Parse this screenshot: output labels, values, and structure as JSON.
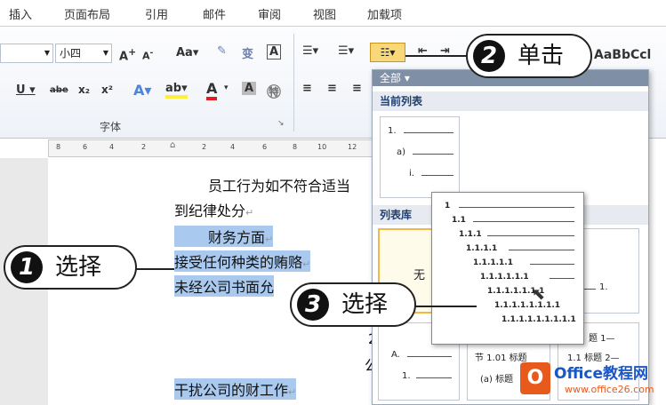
{
  "tabs": [
    "插入",
    "页面布局",
    "引用",
    "邮件",
    "审阅",
    "视图",
    "加载项"
  ],
  "font": {
    "size": "小四",
    "group_label": "字体"
  },
  "ribbon": {
    "grow": "A",
    "shrink": "A",
    "case": "Aa",
    "style_sample": "AaBbCcl"
  },
  "ruler_ticks": [
    "8",
    "6",
    "4",
    "2",
    "2",
    "4",
    "6",
    "8",
    "10",
    "12"
  ],
  "doc": {
    "line1": "员工行为如不符合适当",
    "line2": "到纪律处分",
    "line3": "财务方面",
    "line4": "接受任何种类的贿赂",
    "line5": "未经公司书面允",
    "line6": "干扰公司的财工作",
    "frag1": "公",
    "frag2": "2"
  },
  "panel": {
    "dropdown": "全部 ▾",
    "current_section": "当前列表",
    "library_section": "列表库",
    "current_items": [
      "1.",
      "a)",
      "i."
    ],
    "none_label": "无",
    "lib_items": {
      "a": "A.",
      "b": "1.",
      "c": "节 1.01 标题",
      "d": "(a) 标题",
      "e": "题 1—",
      "f": "1.1 标题 2—"
    }
  },
  "popup_levels": [
    "1",
    "1.1",
    "1.1.1",
    "1.1.1.1",
    "1.1.1.1.1",
    "1.1.1.1.1.1",
    "1.1.1.1.1.1.1",
    "1.1.1.1.1.1.1.1",
    "1.1.1.1.1.1.1.1.1"
  ],
  "callouts": {
    "c1": {
      "num": "1",
      "text": "选择"
    },
    "c2": {
      "num": "2",
      "text": "单击"
    },
    "c3": {
      "num": "3",
      "text": "选择"
    }
  },
  "logo": {
    "brand": "Office教程网",
    "url": "www.office26.com"
  }
}
